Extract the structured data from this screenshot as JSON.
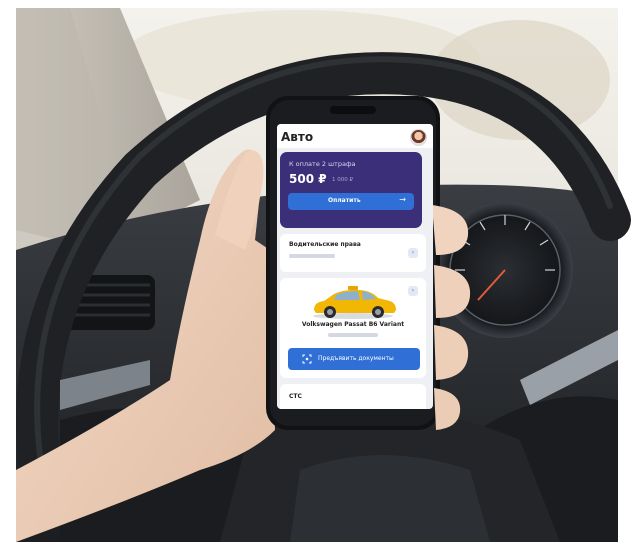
{
  "app": {
    "title": "Авто"
  },
  "fines": {
    "label": "К оплате 2 штрафа",
    "amount": "500 ₽",
    "old_amount": "1 000 ₽",
    "pay_label": "Оплатить",
    "pay_icon": "arrow-right-icon"
  },
  "license": {
    "label": "Водительские права"
  },
  "vehicle": {
    "title": "Volkswagen Passat B6 Variant",
    "docs_button_label": "Предъявить документы",
    "docs_icon": "scan-frame-icon"
  },
  "sts": {
    "label": "СТС"
  },
  "colors": {
    "fines_card": "#3a2f78",
    "accent_blue": "#2f6fd6",
    "taxi_yellow": "#f2b705"
  }
}
